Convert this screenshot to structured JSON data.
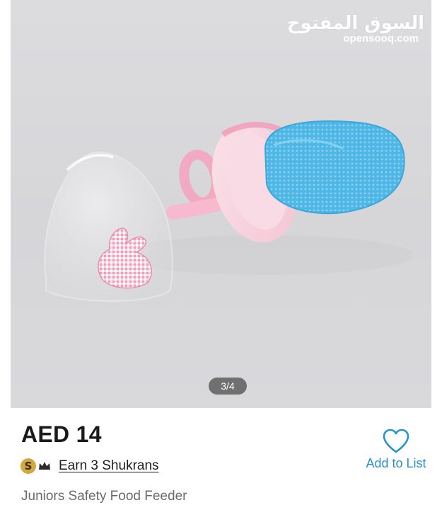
{
  "gallery": {
    "watermark_arabic": "السوق المفتوح",
    "watermark_site": "opensooq.com",
    "page_indicator": "3/4",
    "image_description_icon": "baby-food-feeder-image"
  },
  "product": {
    "price": "AED 14",
    "rewards_badge": "S",
    "rewards_link": "Earn 3 Shukrans",
    "name": "Juniors Safety Food Feeder"
  },
  "actions": {
    "add_to_list": "Add to List"
  },
  "colors": {
    "accent": "#2a92c9",
    "badge_gold": "#d3a843"
  }
}
